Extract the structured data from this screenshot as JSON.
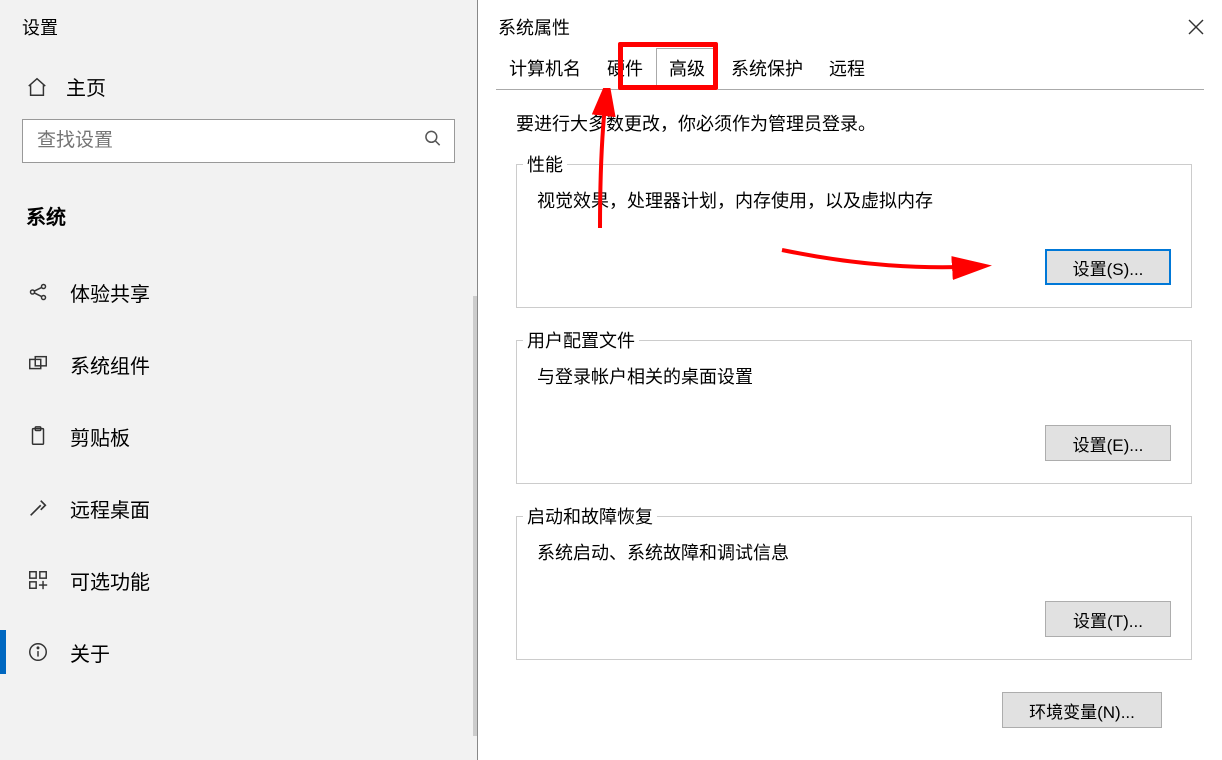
{
  "settings": {
    "title": "设置",
    "home": "主页",
    "search_placeholder": "查找设置",
    "section": "系统",
    "nav": [
      {
        "id": "experience-share",
        "label": "体验共享"
      },
      {
        "id": "system-components",
        "label": "系统组件"
      },
      {
        "id": "clipboard",
        "label": "剪贴板"
      },
      {
        "id": "remote-desktop",
        "label": "远程桌面"
      },
      {
        "id": "optional-features",
        "label": "可选功能"
      },
      {
        "id": "about",
        "label": "关于",
        "selected": true
      }
    ]
  },
  "dialog": {
    "title": "系统属性",
    "tabs": [
      {
        "id": "computer-name",
        "label": "计算机名"
      },
      {
        "id": "hardware",
        "label": "硬件"
      },
      {
        "id": "advanced",
        "label": "高级",
        "active": true
      },
      {
        "id": "system-protect",
        "label": "系统保护"
      },
      {
        "id": "remote",
        "label": "远程"
      }
    ],
    "admin_note": "要进行大多数更改，你必须作为管理员登录。",
    "groups": {
      "performance": {
        "legend": "性能",
        "desc": "视觉效果，处理器计划，内存使用，以及虚拟内存",
        "button": "设置(S)..."
      },
      "user_profiles": {
        "legend": "用户配置文件",
        "desc": "与登录帐户相关的桌面设置",
        "button": "设置(E)..."
      },
      "startup_recovery": {
        "legend": "启动和故障恢复",
        "desc": "系统启动、系统故障和调试信息",
        "button": "设置(T)..."
      }
    },
    "env_button": "环境变量(N)..."
  }
}
